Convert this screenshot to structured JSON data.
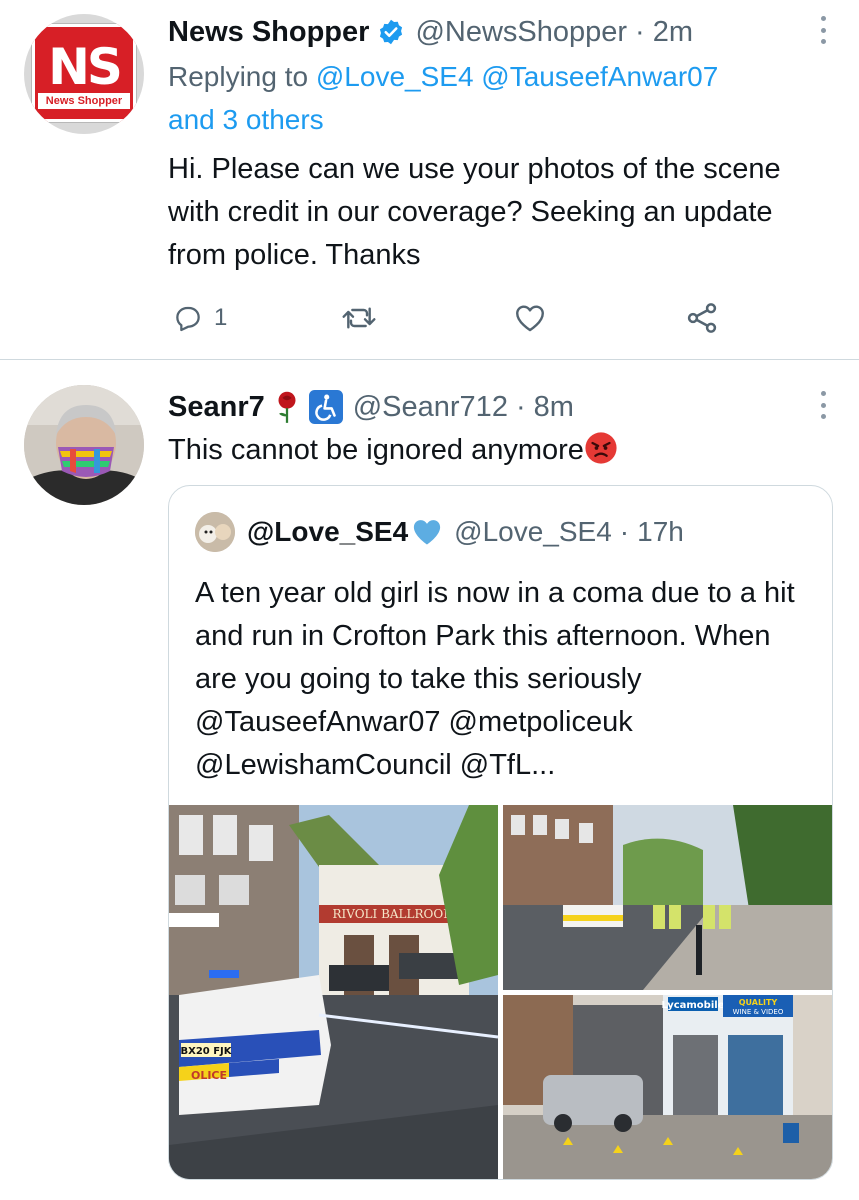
{
  "tweet1": {
    "display_name": "News Shopper",
    "verified_icon": "verified-badge-icon",
    "handle": "@NewsShopper",
    "separator": "·",
    "time": "2m",
    "avatar": {
      "letters": "NS",
      "strip": "News Shopper"
    },
    "replying_prefix": "Replying to",
    "replying_to": [
      "@Love_SE4",
      "@TauseefAnwar07"
    ],
    "replying_more": "and 3 others",
    "text": "Hi. Please can we use your photos of the scene with credit in our coverage? Seeking an update from police. Thanks",
    "actions": {
      "reply_icon": "reply-icon",
      "reply_count": "1",
      "retweet_icon": "retweet-icon",
      "like_icon": "heart-icon",
      "share_icon": "share-icon"
    }
  },
  "tweet2": {
    "display_name": "Seanr7",
    "name_emojis": [
      "rose-icon",
      "wheelchair-icon"
    ],
    "handle": "@Seanr712",
    "separator": "·",
    "time": "8m",
    "text": "This cannot be ignored anymore",
    "text_emoji": "angry-face-icon",
    "quote": {
      "display_name": "@Love_SE4",
      "name_emoji": "blue-heart-icon",
      "handle": "@Love_SE4",
      "separator": "·",
      "time": "17h",
      "text": "A ten year old girl is now in a coma due to a hit and run in Crofton Park this afternoon. When are you going to take this seriously @TauseefAnwar07 @metpoliceuk @LewishamCouncil @TfL...",
      "images": [
        {
          "name": "police-car-rivoli-ballroom-photo",
          "signs": [
            "RIVOLI BALLROOM",
            "BX20 FJK",
            "OLICE"
          ]
        },
        {
          "name": "police-cordon-street-photo"
        },
        {
          "name": "shopfront-evidence-markers-photo",
          "signs": [
            "Lycamobile",
            "QUALITY",
            "WINE & VIDEO"
          ]
        }
      ]
    }
  },
  "colors": {
    "link": "#1d9bf0",
    "muted": "#536471",
    "text": "#0f1419",
    "border": "#cfd9de",
    "brand_red": "#d71f26"
  }
}
